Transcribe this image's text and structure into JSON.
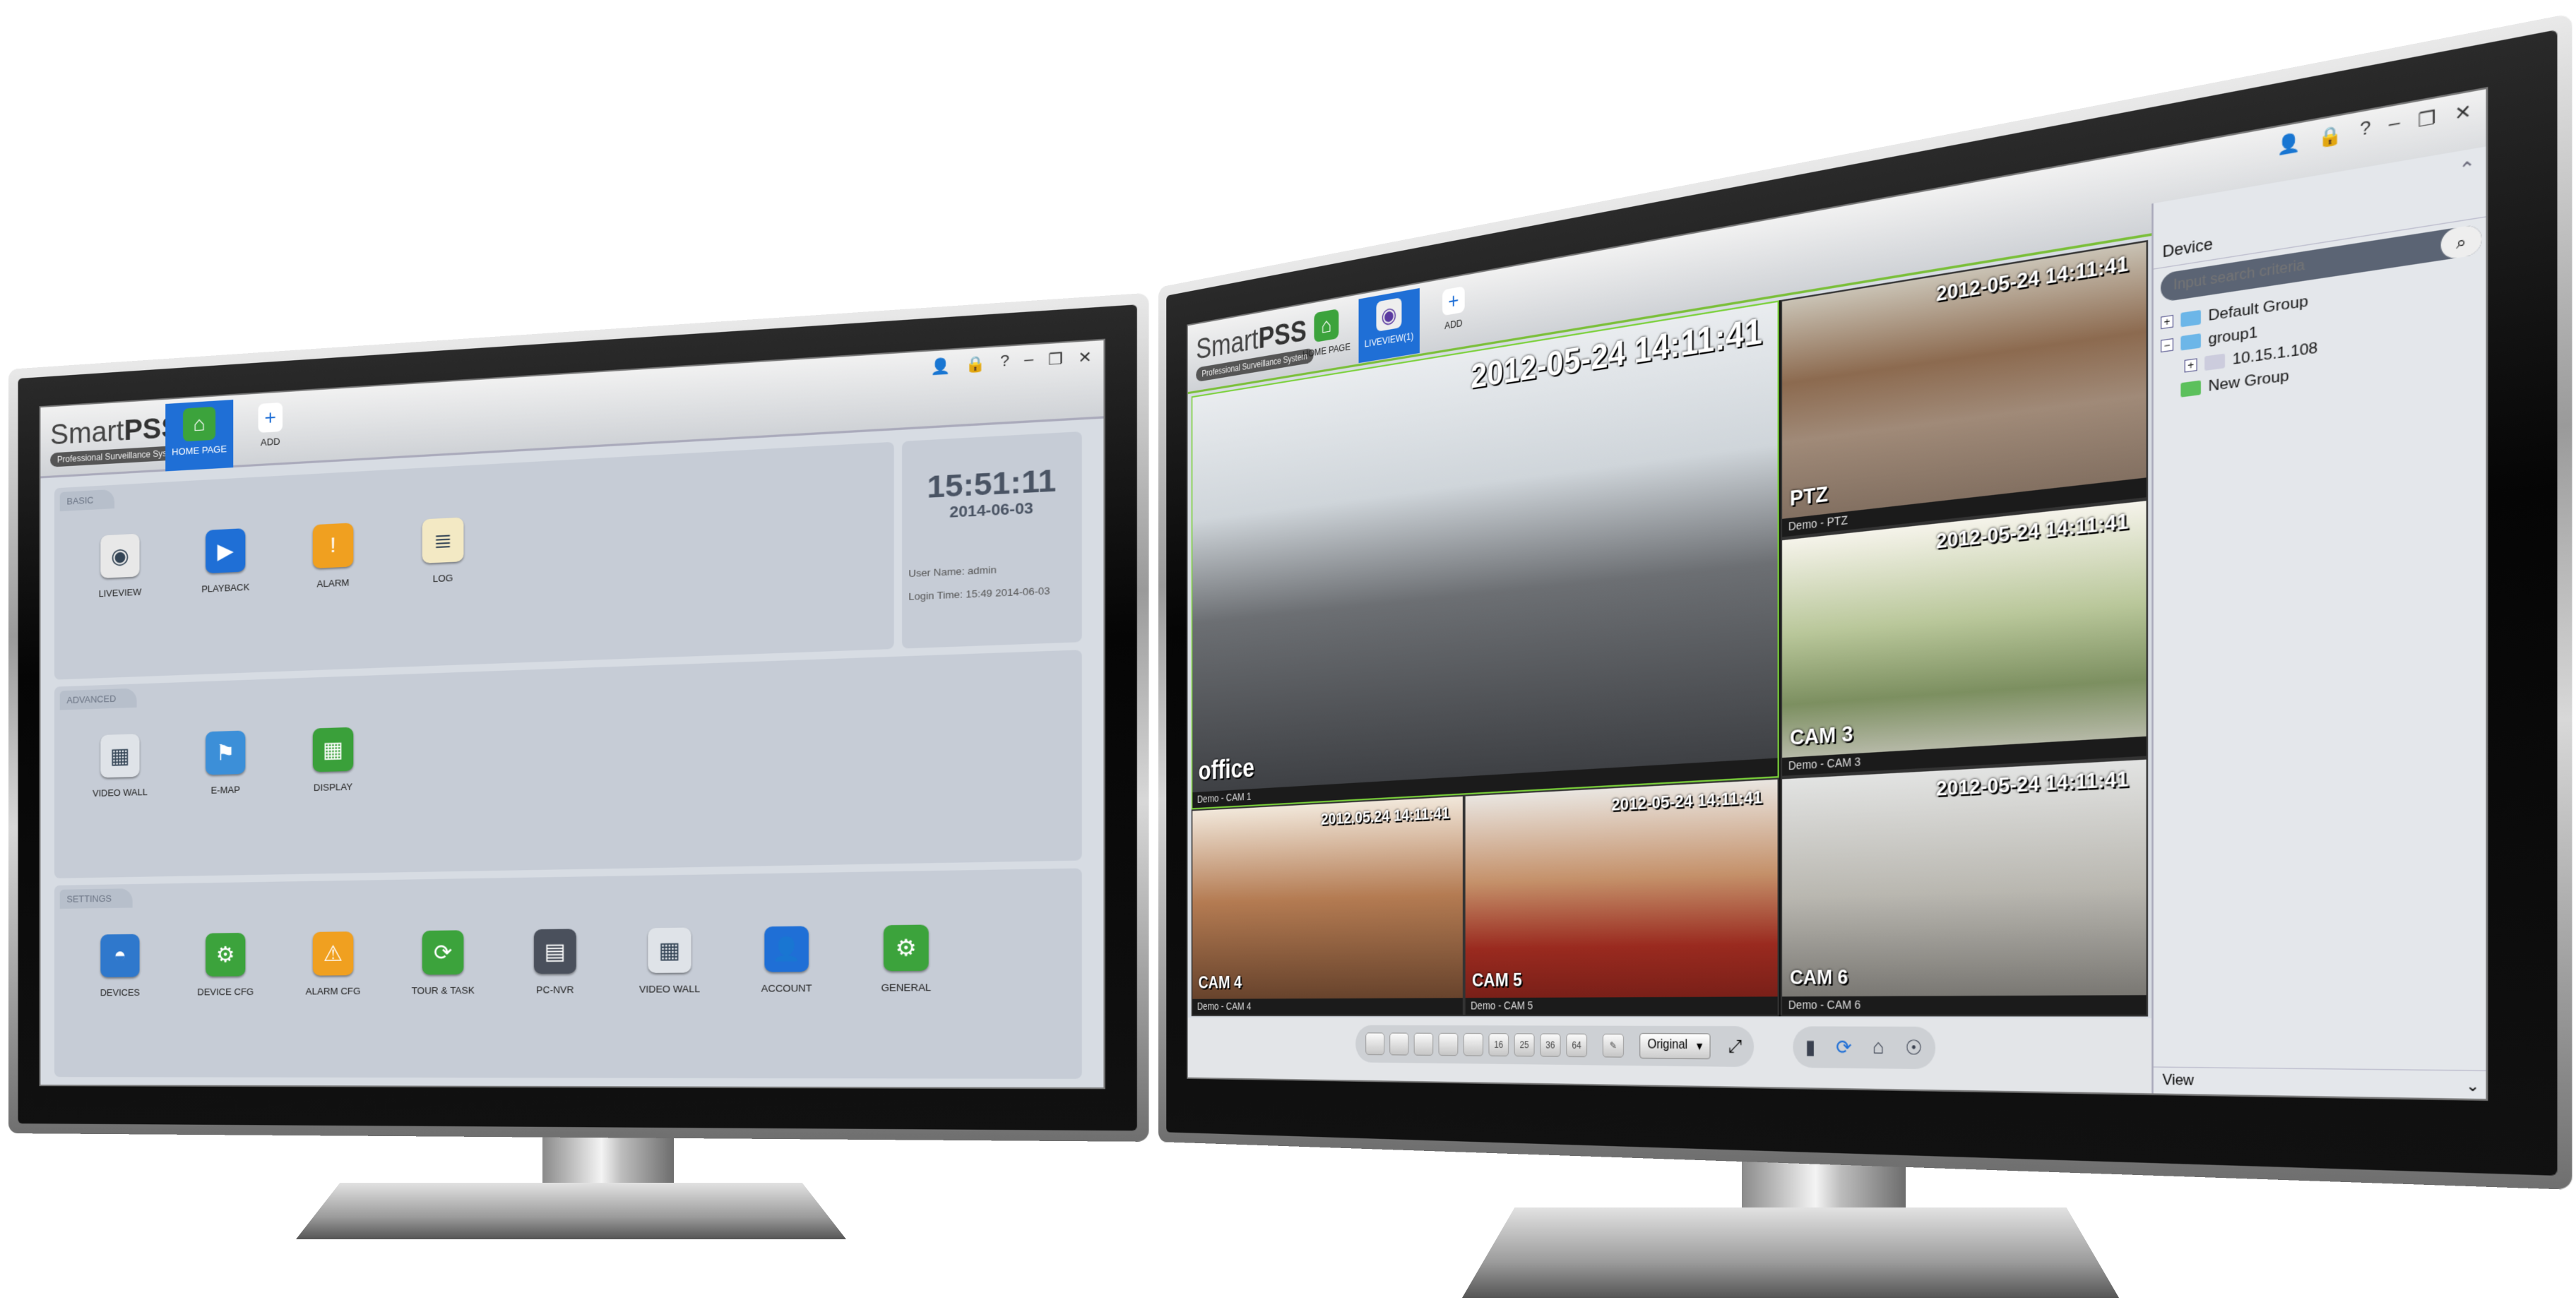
{
  "left_monitor": {
    "logo": {
      "brand_light": "Smart",
      "brand_bold": "PSS",
      "tagline": "Professional Surveillance System"
    },
    "tabs": [
      {
        "label": "HOME PAGE",
        "icon": "home-icon",
        "active": true
      },
      {
        "label": "ADD",
        "icon": "plus-icon",
        "active": false
      }
    ],
    "window_controls": [
      "user-icon",
      "lock-icon",
      "help-icon",
      "minimize-icon",
      "restore-icon",
      "close-icon"
    ],
    "window_control_glyphs": [
      "👤",
      "🔒",
      "?",
      "–",
      "❐",
      "✕"
    ],
    "clock": {
      "time": "15:51:11",
      "date": "2014-06-03",
      "user_name": "User Name: admin",
      "login_time": "Login Time: 15:49 2014-06-03"
    },
    "sections": [
      {
        "title": "BASIC",
        "items": [
          {
            "label": "LIVEVIEW",
            "icon": "camera-icon",
            "color": "#e8e8e8"
          },
          {
            "label": "PLAYBACK",
            "icon": "clapperboard-icon",
            "color": "#1f6fd6"
          },
          {
            "label": "ALARM",
            "icon": "alarm-icon",
            "color": "#f0a020"
          },
          {
            "label": "LOG",
            "icon": "log-icon",
            "color": "#f3e9c4"
          }
        ]
      },
      {
        "title": "ADVANCED",
        "items": [
          {
            "label": "VIDEO WALL",
            "icon": "video-wall-icon",
            "color": "#dfe3e8"
          },
          {
            "label": "E-MAP",
            "icon": "map-icon",
            "color": "#3c8fd8"
          },
          {
            "label": "DISPLAY",
            "icon": "display-icon",
            "color": "#3aa03a"
          }
        ]
      },
      {
        "title": "SETTINGS",
        "items": [
          {
            "label": "DEVICES",
            "icon": "dome-camera-icon",
            "color": "#2f78cc"
          },
          {
            "label": "DEVICE CFG",
            "icon": "device-config-icon",
            "color": "#3ca33c"
          },
          {
            "label": "ALARM CFG",
            "icon": "alarm-config-icon",
            "color": "#f0a020"
          },
          {
            "label": "TOUR & TASK",
            "icon": "tour-task-icon",
            "color": "#3ca33c"
          },
          {
            "label": "PC-NVR",
            "icon": "pc-nvr-icon",
            "color": "#4a505c"
          },
          {
            "label": "VIDEO WALL",
            "icon": "video-wall-config-icon",
            "color": "#dfe3e8"
          },
          {
            "label": "ACCOUNT",
            "icon": "account-icon",
            "color": "#1f6fd6"
          },
          {
            "label": "GENERAL",
            "icon": "general-settings-icon",
            "color": "#3ca33c"
          }
        ]
      }
    ]
  },
  "right_monitor": {
    "logo": {
      "brand_light": "Smart",
      "brand_bold": "PSS",
      "tagline": "Professional Surveillance System"
    },
    "tabs": [
      {
        "label": "HOME PAGE",
        "icon": "home-icon",
        "active": false
      },
      {
        "label": "LIVEVIEW(1)",
        "icon": "camera-icon",
        "active": true
      },
      {
        "label": "ADD",
        "icon": "plus-icon",
        "active": false
      }
    ],
    "cameras": [
      {
        "name": "office",
        "caption": "Demo - CAM 1",
        "timestamp": "2012-05-24   14:11:41",
        "selected": true
      },
      {
        "name": "PTZ",
        "caption": "Demo - PTZ",
        "timestamp": "2012-05-24   14:11:41"
      },
      {
        "name": "CAM 3",
        "caption": "Demo - CAM 3",
        "timestamp": "2012-05-24   14:11:41"
      },
      {
        "name": "CAM 4",
        "caption": "Demo - CAM 4",
        "timestamp": "2012.05.24   14:11:41"
      },
      {
        "name": "CAM 5",
        "caption": "Demo - CAM 5",
        "timestamp": "2012-05-24   14:11:41"
      },
      {
        "name": "CAM 6",
        "caption": "Demo - CAM 6",
        "timestamp": "2012-05-24   14:11:41"
      }
    ],
    "toolbar": {
      "layouts": [
        "",
        "",
        "",
        "",
        "",
        "16",
        "25",
        "36",
        "64"
      ],
      "stream_select": "Original",
      "right_icons": [
        "record-icon",
        "tour-icon",
        "alarm-bell-icon",
        "talk-icon"
      ],
      "right_glyphs": [
        "▮",
        "⟳",
        "⌂",
        "☉"
      ]
    },
    "side_panel": {
      "device_header": "Device",
      "search_placeholder": "Input search criteria",
      "tree": [
        {
          "label": "Default Group",
          "toggle": "+",
          "level": 0
        },
        {
          "label": "group1",
          "toggle": "−",
          "level": 0
        },
        {
          "label": "10.15.1.108",
          "toggle": "+",
          "level": 1
        },
        {
          "label": "New Group",
          "toggle": "",
          "level": 0
        }
      ],
      "view_label": "View"
    }
  }
}
